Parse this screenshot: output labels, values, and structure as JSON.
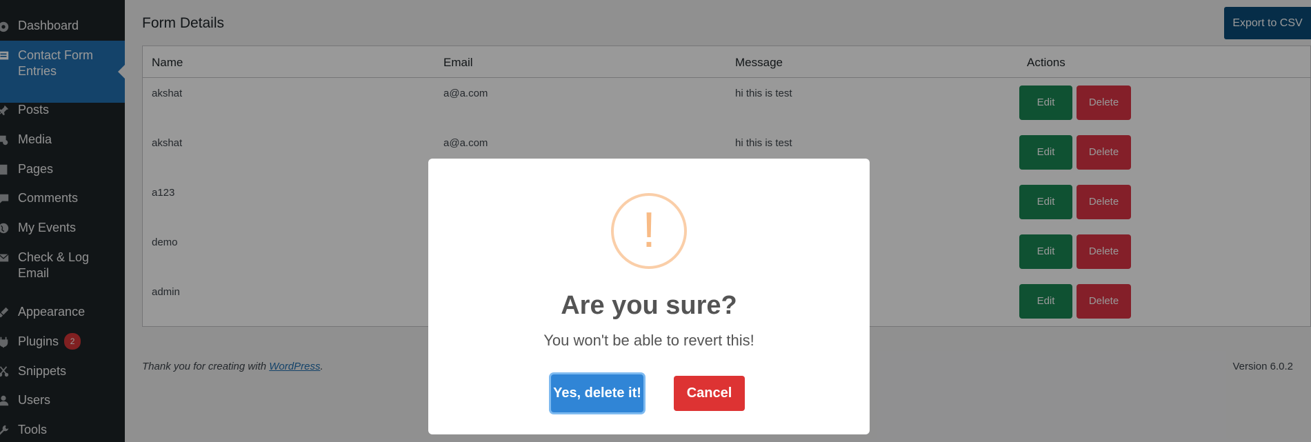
{
  "sidebar": {
    "items": [
      {
        "label": "Dashboard",
        "icon": "dashboard-icon"
      },
      {
        "label": "Contact Form Entries",
        "icon": "contact-form-icon"
      },
      {
        "label": "Posts",
        "icon": "pin-icon"
      },
      {
        "label": "Media",
        "icon": "media-icon"
      },
      {
        "label": "Pages",
        "icon": "page-icon"
      },
      {
        "label": "Comments",
        "icon": "comment-icon"
      },
      {
        "label": "My Events",
        "icon": "globe-icon"
      },
      {
        "label": "Check & Log Email",
        "icon": "email-icon"
      },
      {
        "label": "Appearance",
        "icon": "brush-icon"
      },
      {
        "label": "Plugins",
        "icon": "plug-icon",
        "badge": "2"
      },
      {
        "label": "Snippets",
        "icon": "scissors-icon"
      },
      {
        "label": "Users",
        "icon": "user-icon"
      },
      {
        "label": "Tools",
        "icon": "wrench-icon"
      }
    ]
  },
  "main": {
    "title": "Form Details",
    "export_label": "Export to CSV",
    "table": {
      "headers": [
        "Name",
        "Email",
        "Message",
        "Actions"
      ],
      "rows": [
        {
          "name": "akshat",
          "email": "a@a.com",
          "message": "hi this is test"
        },
        {
          "name": "akshat",
          "email": "a@a.com",
          "message": "hi this is test"
        },
        {
          "name": "a123",
          "email": "",
          "message": ""
        },
        {
          "name": "demo",
          "email": "",
          "message": ""
        },
        {
          "name": "admin",
          "email": "",
          "message": ""
        }
      ],
      "edit_label": "Edit",
      "delete_label": "Delete"
    },
    "footer": {
      "thanks_prefix": "Thank you for creating with ",
      "thanks_link": "WordPress",
      "thanks_suffix": ".",
      "version": "Version 6.0.2"
    }
  },
  "dialog": {
    "icon_glyph": "!",
    "title": "Are you sure?",
    "text": "You won't be able to revert this!",
    "confirm_label": "Yes, delete it!",
    "cancel_label": "Cancel"
  },
  "colors": {
    "sidebar_bg": "#1d2327",
    "active_bg": "#2271b1",
    "edit_green": "#198754",
    "delete_red": "#dc3545",
    "confirm_blue": "#3085d6",
    "cancel_red": "#dd3333",
    "warning_orange": "#f8bb86"
  }
}
